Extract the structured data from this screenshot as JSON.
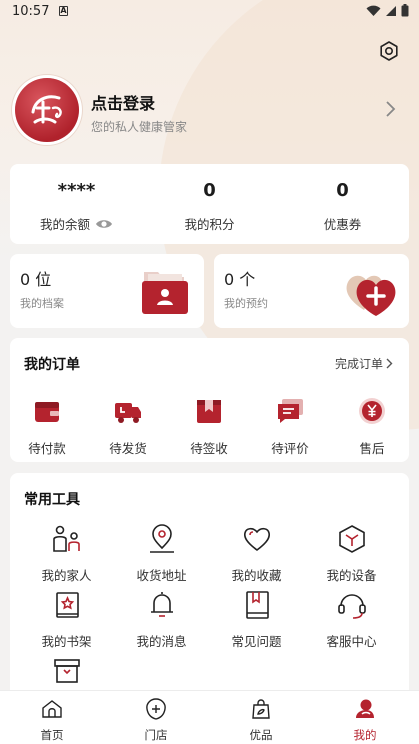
{
  "status_bar": {
    "time": "10:57",
    "notif_glyph": "A"
  },
  "profile": {
    "login_title": "点击登录",
    "login_subtitle": "您的私人健康管家"
  },
  "stats": [
    {
      "value": "****",
      "label": "我的余额"
    },
    {
      "value": "0",
      "label": "我的积分"
    },
    {
      "value": "0",
      "label": "优惠券"
    }
  ],
  "archive": {
    "count": "0 位",
    "label": "我的档案"
  },
  "booking": {
    "count": "0 个",
    "label": "我的预约"
  },
  "orders": {
    "title": "我的订单",
    "link": "完成订单",
    "items": [
      {
        "label": "待付款",
        "icon": "wallet-icon"
      },
      {
        "label": "待发货",
        "icon": "truck-icon"
      },
      {
        "label": "待签收",
        "icon": "package-icon"
      },
      {
        "label": "待评价",
        "icon": "comment-icon"
      },
      {
        "label": "售后",
        "icon": "yuan-coin-icon"
      }
    ]
  },
  "tools": {
    "title": "常用工具",
    "items": [
      {
        "label": "我的家人",
        "icon": "family-icon"
      },
      {
        "label": "收货地址",
        "icon": "location-icon"
      },
      {
        "label": "我的收藏",
        "icon": "heart-icon"
      },
      {
        "label": "我的设备",
        "icon": "cube-icon"
      },
      {
        "label": "我的书架",
        "icon": "bookshelf-icon"
      },
      {
        "label": "我的消息",
        "icon": "bell-icon"
      },
      {
        "label": "常见问题",
        "icon": "book-icon"
      },
      {
        "label": "客服中心",
        "icon": "headset-icon"
      },
      {
        "label": "",
        "icon": "gift-icon"
      }
    ]
  },
  "tabbar": {
    "items": [
      {
        "label": "首页",
        "icon": "home-icon"
      },
      {
        "label": "门店",
        "icon": "store-icon"
      },
      {
        "label": "优品",
        "icon": "shopping-bag-icon"
      },
      {
        "label": "我的",
        "icon": "profile-icon",
        "active": true
      }
    ]
  },
  "colors": {
    "accent": "#b4232e",
    "background": "#f3f2f1"
  }
}
